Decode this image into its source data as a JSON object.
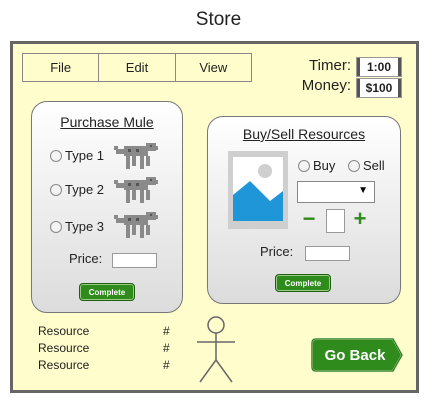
{
  "page": {
    "title": "Store"
  },
  "menu": {
    "items": [
      "File",
      "Edit",
      "View"
    ]
  },
  "status": {
    "timer_label": "Timer:",
    "timer_value": "1:00",
    "money_label": "Money:",
    "money_value": "$100"
  },
  "purchase": {
    "title": "Purchase Mule",
    "types": [
      "Type 1",
      "Type 2",
      "Type 3"
    ],
    "price_label": "Price:",
    "complete_label": "Complete",
    "mule_icon": "mule-icon"
  },
  "trade": {
    "title": "Buy/Sell Resources",
    "buy_label": "Buy",
    "sell_label": "Sell",
    "select_value": "",
    "minus": "−",
    "plus": "+",
    "price_label": "Price:",
    "complete_label": "Complete",
    "image_icon": "image-placeholder-icon"
  },
  "resources": {
    "rows": [
      {
        "label": "Resource",
        "value": "#"
      },
      {
        "label": "Resource",
        "value": "#"
      },
      {
        "label": "Resource",
        "value": "#"
      }
    ]
  },
  "nav": {
    "go_back_label": "Go Back"
  },
  "colors": {
    "background": "#fffdcc",
    "button_green": "#2e8b1c",
    "image_blue": "#1f96d8"
  }
}
